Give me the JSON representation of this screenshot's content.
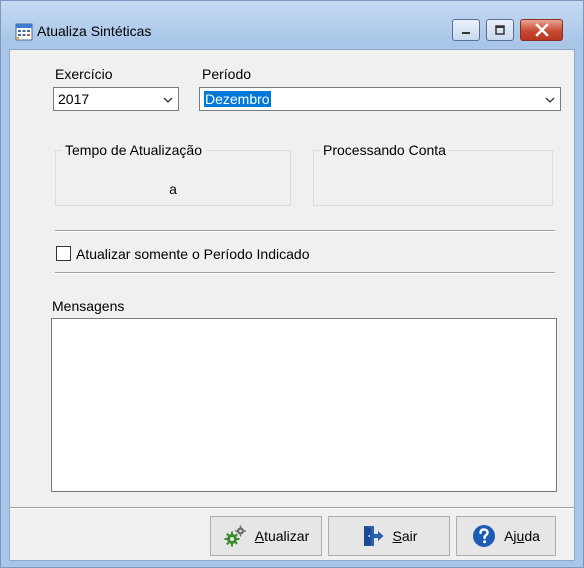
{
  "window": {
    "title": "Atualiza Sintéticas"
  },
  "form": {
    "exercicio_label": "Exercício",
    "exercicio_value": "2017",
    "periodo_label": "Período",
    "periodo_value": "Dezembro",
    "tempo_group_title": "Tempo de Atualização",
    "tempo_value": "a",
    "processando_group_title": "Processando Conta",
    "checkbox_label": "Atualizar somente o Período Indicado",
    "checkbox_checked": false,
    "mensagens_label": "Mensagens"
  },
  "buttons": {
    "atualizar": {
      "pre": "",
      "accel": "A",
      "post": "tualizar"
    },
    "sair": {
      "pre": "",
      "accel": "S",
      "post": "air"
    },
    "ajuda": {
      "pre": "Aj",
      "accel": "u",
      "post": "da"
    }
  },
  "colors": {
    "selection": "#0078d7",
    "close_button": "#c84a33",
    "frame": "#a9c6e8"
  }
}
